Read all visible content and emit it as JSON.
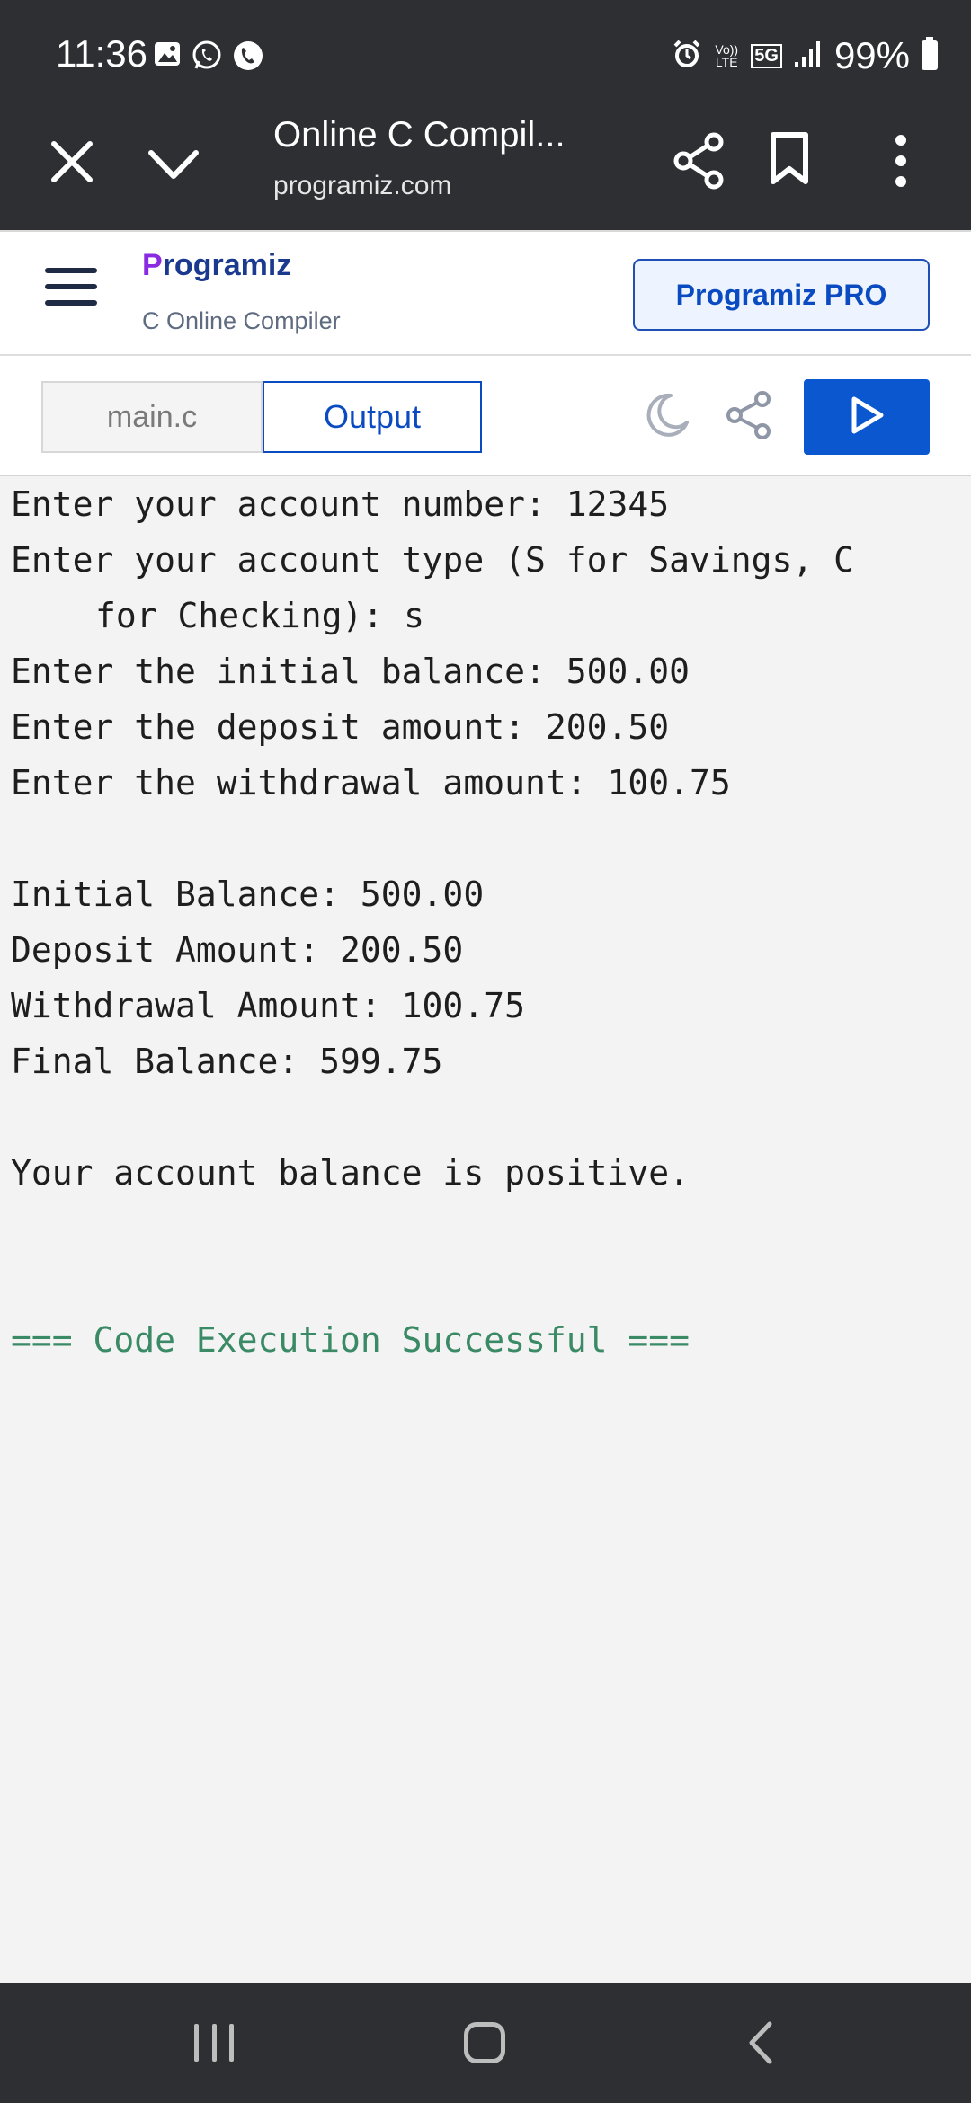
{
  "status_bar": {
    "time": "11:36",
    "battery": "99%",
    "network": "5G",
    "volte": "Vo)) LTE"
  },
  "browser": {
    "title": "Online C Compil...",
    "url": "programiz.com"
  },
  "site": {
    "logo_text": "rogramiz",
    "logo_mark": "P",
    "subtitle": "C Online Compiler",
    "pro_button": "Programiz PRO"
  },
  "compiler": {
    "tab_main": "main.c",
    "tab_output": "Output"
  },
  "output": {
    "lines": [
      "Enter your account number: 12345",
      "Enter your account type (S for Savings, C",
      "for Checking): s",
      "Enter the initial balance: 500.00",
      "Enter the deposit amount: 200.50",
      "Enter the withdrawal amount: 100.75",
      "Initial Balance: 500.00",
      "Deposit Amount: 200.50",
      "Withdrawal Amount: 100.75",
      "Final Balance: 599.75",
      "Your account balance is positive.",
      "=== Code Execution Successful ==="
    ]
  },
  "colors": {
    "accent": "#0b57d0",
    "success": "#3b8a66",
    "system_bar": "#2e2f33"
  }
}
